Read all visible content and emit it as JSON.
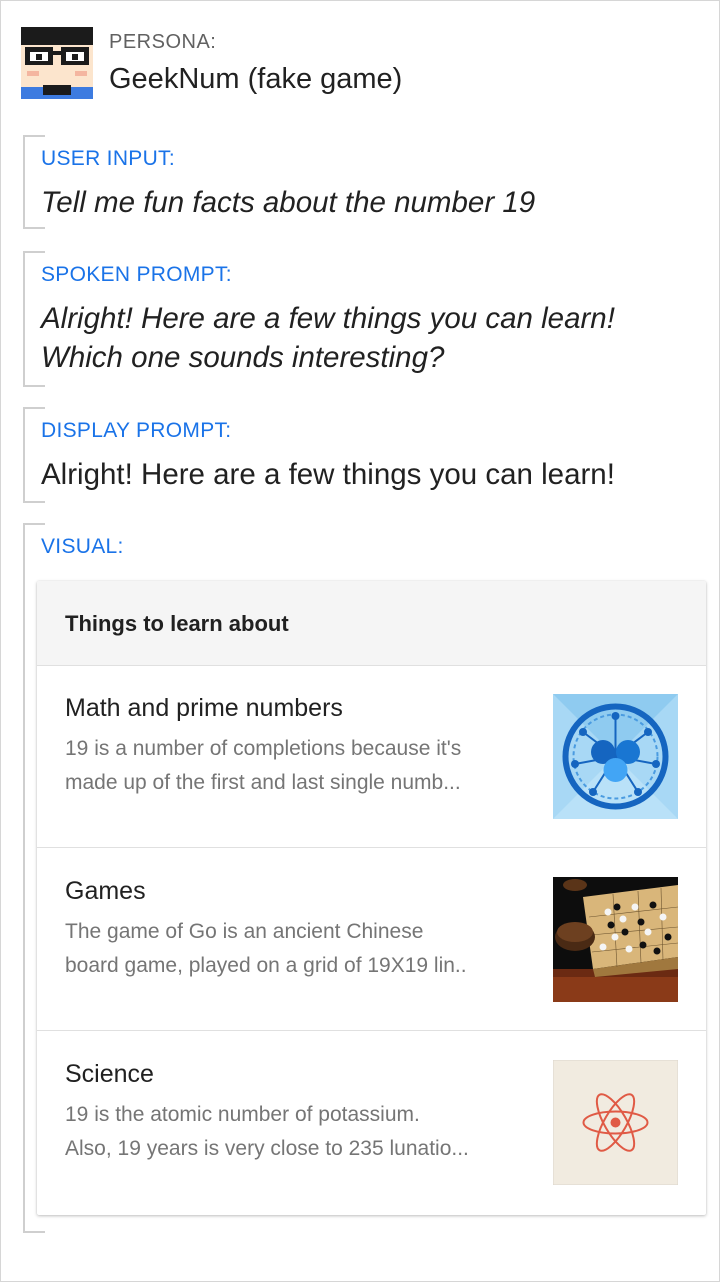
{
  "persona": {
    "label": "PERSONA:",
    "name": "GeekNum (fake game)",
    "avatar_icon": "geek-glasses-avatar-icon"
  },
  "user_input": {
    "label": "USER INPUT:",
    "text": "Tell me fun facts about the number 19"
  },
  "spoken_prompt": {
    "label": "SPOKEN PROMPT:",
    "line1": "Alright! Here are a few things you can learn!",
    "line2": "Which one sounds interesting?"
  },
  "display_prompt": {
    "label": "DISPLAY PROMPT:",
    "text": "Alright! Here are a few things you can learn!"
  },
  "visual": {
    "label": "VISUAL:",
    "card_title": "Things to learn about",
    "items": [
      {
        "title": "Math and prime numbers",
        "desc_line1": "19 is a number of completions because it's",
        "desc_line2": "made up of the first and last single numb...",
        "thumb_icon": "math-network-icon"
      },
      {
        "title": "Games",
        "desc_line1": "The game of Go is an ancient Chinese",
        "desc_line2": "board game, played on a grid of 19X19 lin..",
        "thumb_icon": "go-board-icon"
      },
      {
        "title": "Science",
        "desc_line1": "19 is the atomic number of potassium.",
        "desc_line2": "Also, 19 years is very close to 235 lunatio...",
        "thumb_icon": "atom-icon"
      }
    ]
  },
  "colors": {
    "accent": "#1a73e8",
    "muted_text": "#757575",
    "bracket": "#cfcfcf"
  }
}
